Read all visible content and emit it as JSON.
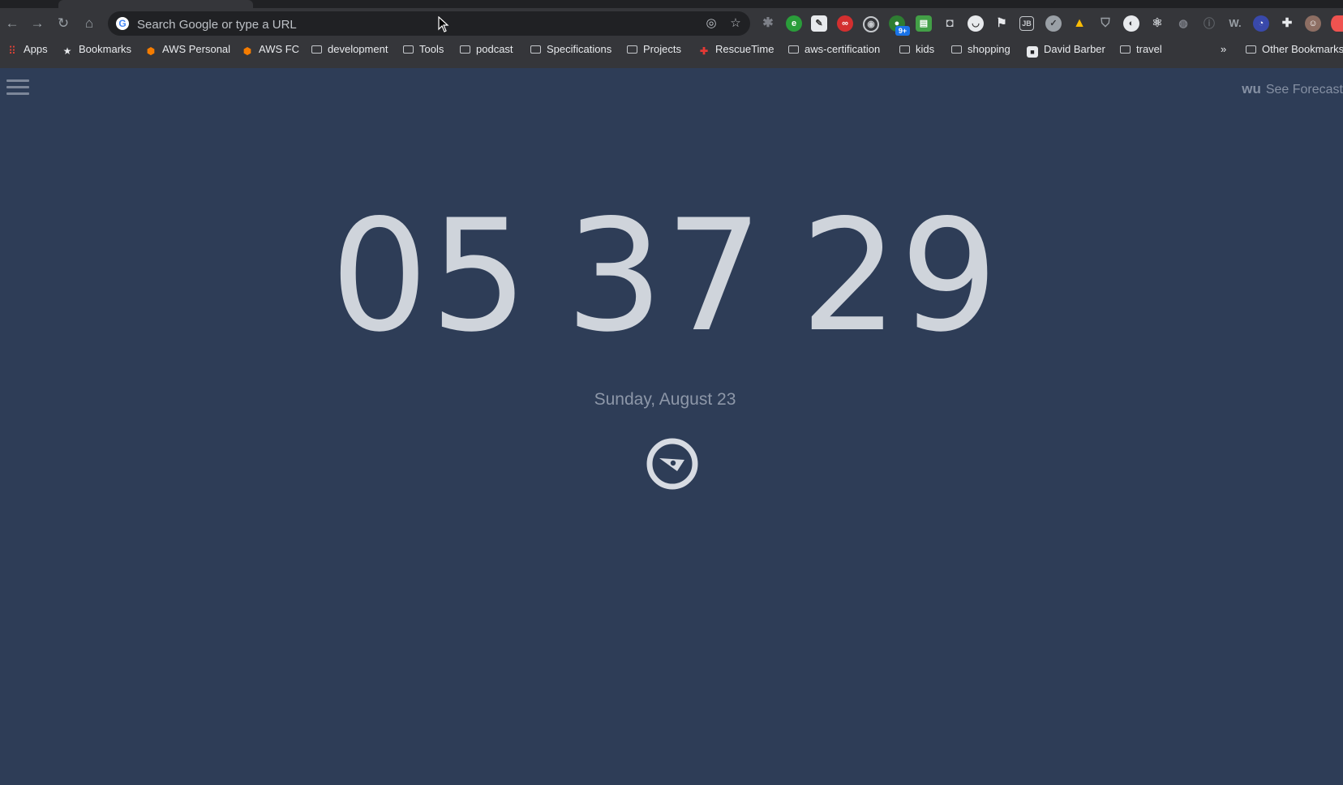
{
  "browser": {
    "omnibox_placeholder": "Search Google or type a URL",
    "bookmarks": [
      {
        "label": "Apps",
        "icon": "apps-grid-icon"
      },
      {
        "label": "Bookmarks",
        "icon": "star-icon"
      },
      {
        "label": "AWS Personal",
        "icon": "aws-cube-icon"
      },
      {
        "label": "AWS FC",
        "icon": "aws-cube-icon"
      },
      {
        "label": "development",
        "icon": "folder-icon"
      },
      {
        "label": "Tools",
        "icon": "folder-icon"
      },
      {
        "label": "podcast",
        "icon": "folder-icon"
      },
      {
        "label": "Specifications",
        "icon": "folder-icon"
      },
      {
        "label": "Projects",
        "icon": "folder-icon"
      },
      {
        "label": "RescueTime",
        "icon": "rescuetime-icon"
      },
      {
        "label": "aws-certification",
        "icon": "folder-icon"
      },
      {
        "label": "kids",
        "icon": "folder-icon"
      },
      {
        "label": "shopping",
        "icon": "folder-icon"
      },
      {
        "label": "David Barber",
        "icon": "square-logo-icon"
      },
      {
        "label": "travel",
        "icon": "folder-icon"
      }
    ],
    "overflow_label": "»",
    "other_bookmarks": "Other Bookmarks",
    "extension_badge": "9+"
  },
  "page": {
    "forecast_brand": "wu",
    "forecast_label": "See Forecast",
    "clock": {
      "hours": "05",
      "minutes": "37",
      "seconds": "29"
    },
    "date": "Sunday, August 23"
  },
  "colors": {
    "background": "#2e3d57",
    "clock_text": "#dde1e7",
    "date_text": "#8d97a8"
  }
}
